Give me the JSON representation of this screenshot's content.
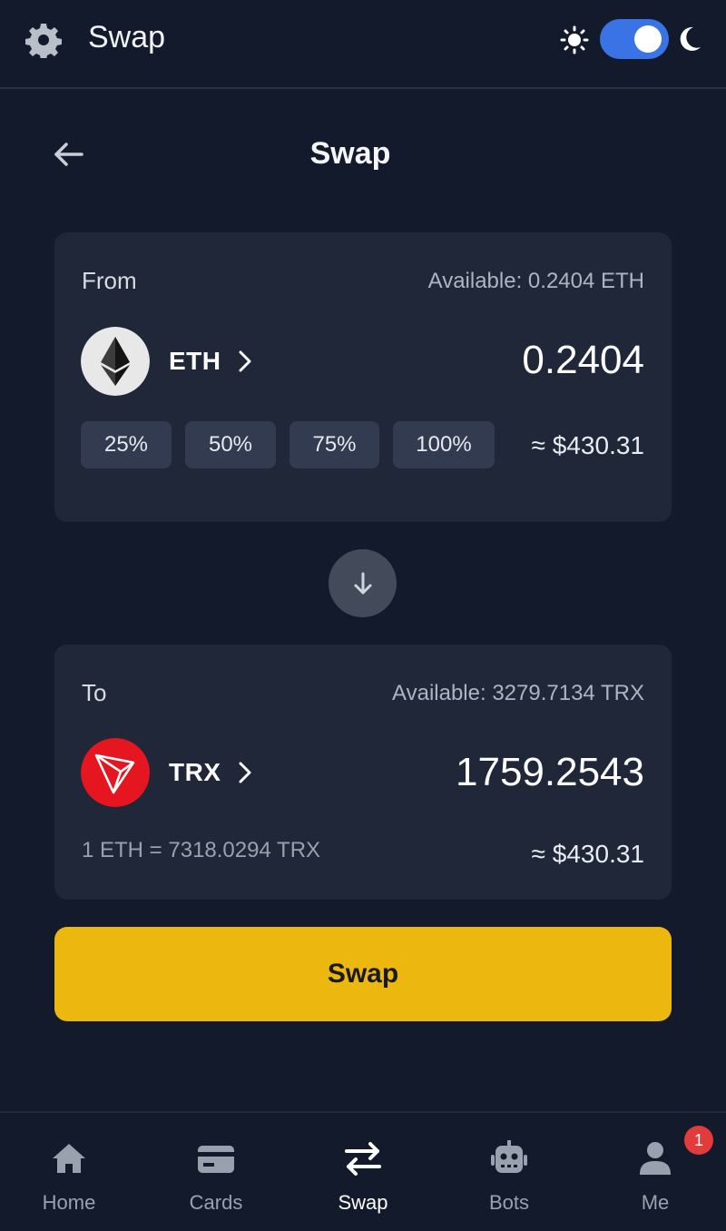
{
  "header": {
    "title": "Swap"
  },
  "page": {
    "title": "Swap"
  },
  "from": {
    "label": "From",
    "available": "Available: 0.2404 ETH",
    "coin": "ETH",
    "amount": "0.2404",
    "percent_buttons": [
      "25%",
      "50%",
      "75%",
      "100%"
    ],
    "usd_value": "≈ $430.31"
  },
  "to": {
    "label": "To",
    "available": "Available: 3279.7134 TRX",
    "coin": "TRX",
    "amount": "1759.2543",
    "rate": "1 ETH = 7318.0294 TRX",
    "usd_value": "≈ $430.31"
  },
  "action": {
    "swap_label": "Swap"
  },
  "nav": {
    "items": [
      {
        "label": "Home",
        "icon": "home-icon"
      },
      {
        "label": "Cards",
        "icon": "card-icon"
      },
      {
        "label": "Swap",
        "icon": "swap-arrows-icon",
        "active": true
      },
      {
        "label": "Bots",
        "icon": "robot-icon"
      },
      {
        "label": "Me",
        "icon": "user-icon"
      }
    ],
    "badge_count": "1"
  },
  "colors": {
    "background": "#131a2b",
    "card": "#1f2738",
    "accent_yellow": "#ecb80f",
    "toggle_blue": "#3a73e6",
    "trx_red": "#e5161f",
    "badge_red": "#e23b3b"
  }
}
